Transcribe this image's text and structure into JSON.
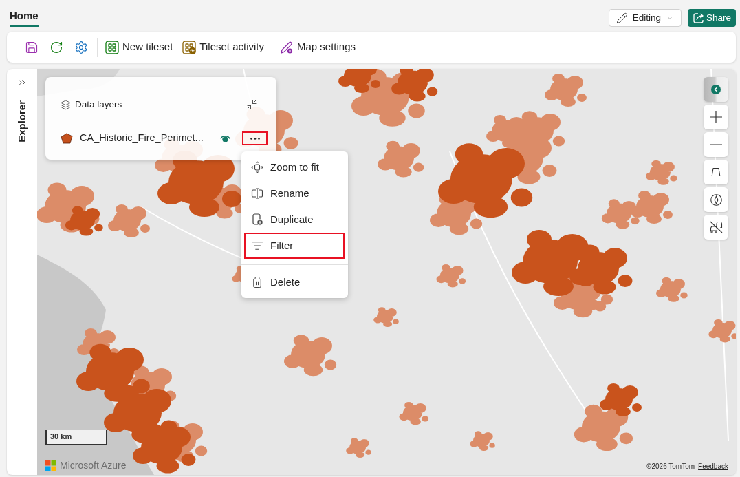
{
  "header": {
    "tabs": [
      {
        "label": "Home",
        "selected": true
      }
    ],
    "mode_button": {
      "label": "Editing"
    },
    "share_button": {
      "label": "Share"
    }
  },
  "toolbar": {
    "buttons": [
      {
        "label": "New tileset"
      },
      {
        "label": "Tileset activity"
      },
      {
        "label": "Map settings"
      }
    ]
  },
  "explorer": {
    "label": "Explorer"
  },
  "data_layers": {
    "title": "Data layers",
    "layers": [
      {
        "name": "CA_Historic_Fire_Perimet...",
        "color": "#c4501c",
        "visible": true,
        "menu_button_highlighted": true
      }
    ]
  },
  "context_menu": {
    "groups": [
      {
        "items": [
          {
            "label": "Zoom to fit",
            "highlighted": false
          },
          {
            "label": "Rename",
            "highlighted": false
          },
          {
            "label": "Duplicate",
            "highlighted": false
          },
          {
            "label": "Filter",
            "highlighted": true
          }
        ]
      },
      {
        "items": [
          {
            "label": "Delete",
            "highlighted": false
          }
        ]
      }
    ]
  },
  "map": {
    "scale": "30 km",
    "logo": "Microsoft Azure",
    "attribution": "©2026 TomTom",
    "feedback_link": "Feedback"
  }
}
